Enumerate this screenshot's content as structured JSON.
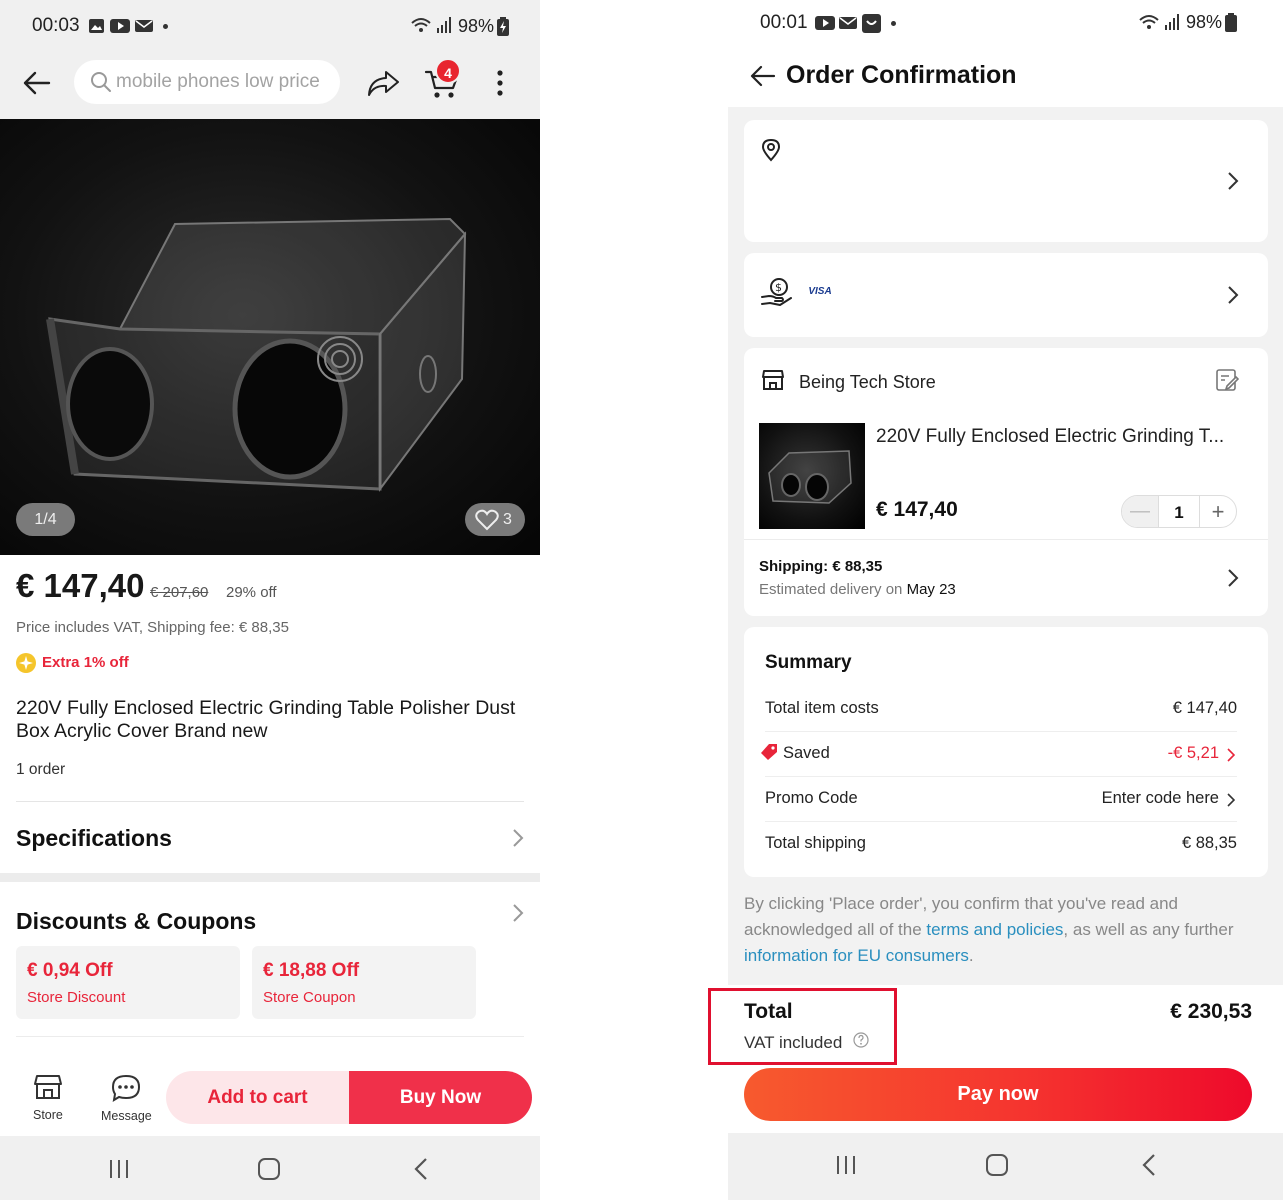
{
  "left_screen": {
    "status": {
      "time": "00:03",
      "battery": "98%"
    },
    "search": {
      "placeholder": "mobile phones low price"
    },
    "cart_badge": "4",
    "image": {
      "counter": "1/4",
      "likes": "3"
    },
    "price": {
      "current": "€ 147,40",
      "original": "€ 207,60",
      "discount": "29% off"
    },
    "vat_shipping": "Price includes VAT, Shipping fee: € 88,35",
    "extra_offer": "Extra 1% off",
    "product_title": "220V Fully Enclosed Electric Grinding Table Polisher Dust Box Acrylic Cover Brand new",
    "orders": "1 order",
    "specifications_label": "Specifications",
    "discounts_label": "Discounts & Coupons",
    "coupons": [
      {
        "amount": "€ 0,94 Off",
        "label": "Store Discount"
      },
      {
        "amount": "€ 18,88 Off",
        "label": "Store Coupon"
      }
    ],
    "bottom_bar": {
      "store_label": "Store",
      "message_label": "Message",
      "add_to_cart": "Add to cart",
      "buy_now": "Buy Now"
    }
  },
  "right_screen": {
    "status": {
      "time": "00:01",
      "battery": "98%"
    },
    "title": "Order Confirmation",
    "payment": {
      "card_brand": "VISA"
    },
    "store": {
      "name": "Being Tech Store",
      "item_title": "220V Fully Enclosed Electric Grinding T...",
      "item_price": "€ 147,40",
      "quantity": "1",
      "shipping": "Shipping: € 88,35",
      "delivery_prefix": "Estimated delivery on ",
      "delivery_date": "May 23"
    },
    "summary": {
      "title": "Summary",
      "rows": [
        {
          "label": "Total item costs",
          "value": "€ 147,40"
        },
        {
          "label": "Saved",
          "value": "-€ 5,21"
        },
        {
          "label": "Promo Code",
          "value": "Enter code here"
        },
        {
          "label": "Total shipping",
          "value": "€ 88,35"
        }
      ]
    },
    "terms": {
      "part1": "By clicking 'Place order', you confirm that you've read and acknowledged all of the ",
      "link1": "terms and policies",
      "part2": ", as well as any further ",
      "link2": "information for EU consumers",
      "part3": "."
    },
    "total": {
      "label": "Total",
      "vat": "VAT included",
      "amount": "€ 230,53"
    },
    "pay_now": "Pay now"
  },
  "colors": {
    "accent_red": "#e8253a",
    "buy_button": "#f0304a",
    "link_blue": "#2a8fbf",
    "highlight_box": "#e0102f"
  }
}
